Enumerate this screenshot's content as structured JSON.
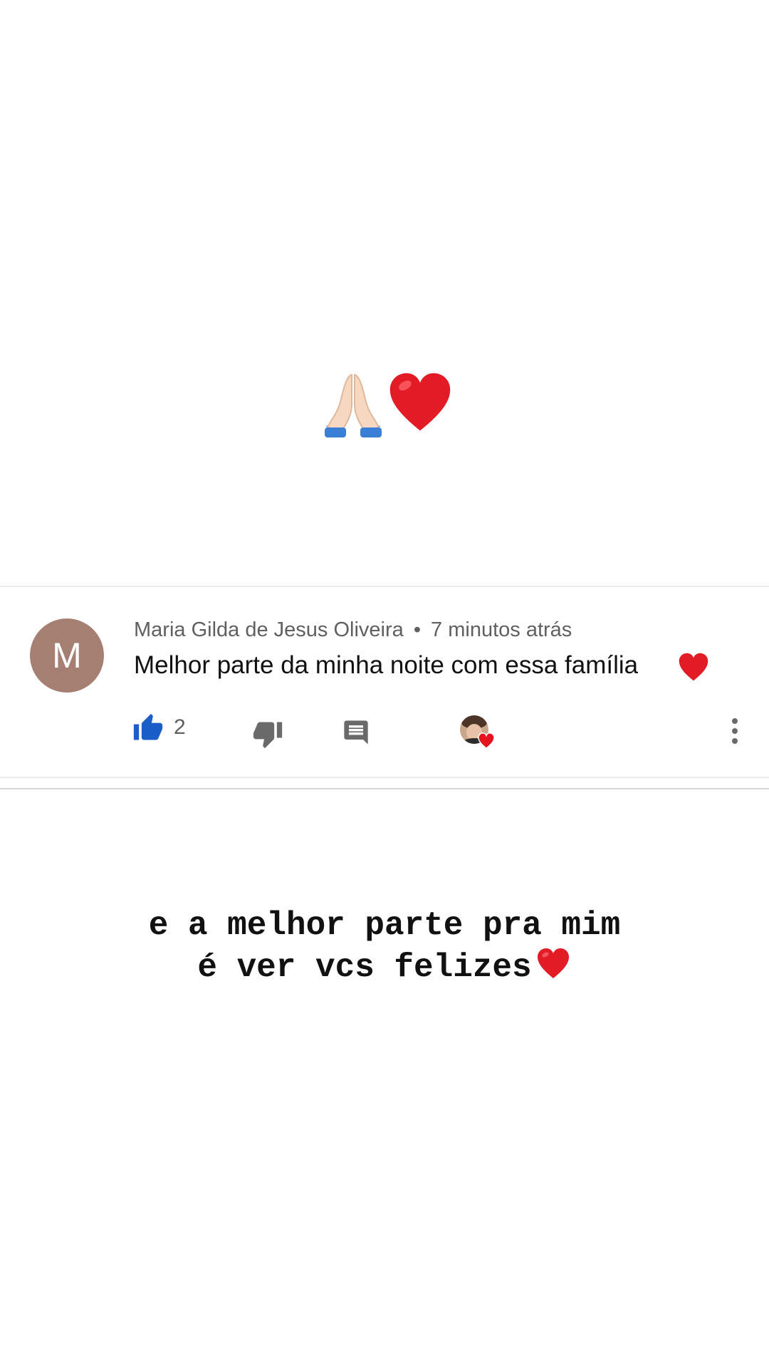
{
  "sticker": {
    "icons": [
      "folded-hands-emoji",
      "red-heart-emoji"
    ]
  },
  "comment": {
    "avatar_letter": "M",
    "author": "Maria Gilda de Jesus Oliveira",
    "separator": "•",
    "time": "7 minutos atrás",
    "text": "Melhor parte da minha noite com essa família",
    "text_emoji": "red-heart-emoji",
    "like_count": "2",
    "colors": {
      "avatar": "#a57f72",
      "like_active": "#1a5fc8",
      "icon_gray": "#6a6a6a"
    }
  },
  "caption": {
    "line1": "e a melhor parte pra mim",
    "line2": "é ver vcs felizes",
    "emoji": "red-heart-emoji"
  }
}
